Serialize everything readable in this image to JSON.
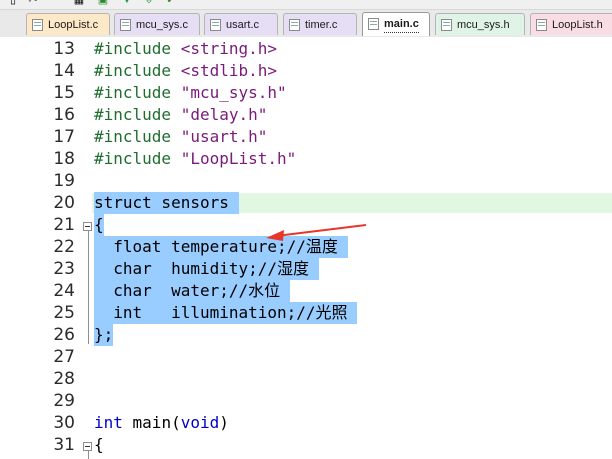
{
  "toolbar": {
    "icons": [
      "document-icon",
      "scissors-icon",
      "grid-icon",
      "save-icon",
      "download-icon",
      "export-icon"
    ]
  },
  "tabs": [
    {
      "label": "LoopList.c",
      "color": "#fde9c7",
      "active": false
    },
    {
      "label": "mcu_sys.c",
      "color": "#e6def4",
      "active": false
    },
    {
      "label": "usart.c",
      "color": "#e6def4",
      "active": false
    },
    {
      "label": "timer.c",
      "color": "#e6def4",
      "active": false
    },
    {
      "label": "main.c",
      "color": "#ffffff",
      "active": true
    },
    {
      "label": "mcu_sys.h",
      "color": "#dff3e6",
      "active": false
    },
    {
      "label": "LoopList.h",
      "color": "#f9dde4",
      "active": false
    }
  ],
  "editor": {
    "lines": [
      {
        "num": "13",
        "text": "#include <string.h>"
      },
      {
        "num": "14",
        "text": "#include <stdlib.h>"
      },
      {
        "num": "15",
        "text": "#include \"mcu_sys.h\""
      },
      {
        "num": "16",
        "text": "#include \"delay.h\""
      },
      {
        "num": "17",
        "text": "#include \"usart.h\""
      },
      {
        "num": "18",
        "text": "#include \"LoopList.h\""
      },
      {
        "num": "19",
        "text": ""
      },
      {
        "num": "20",
        "text": "struct sensors "
      },
      {
        "num": "21",
        "text": "{"
      },
      {
        "num": "22",
        "text": "  float temperature;//温度 "
      },
      {
        "num": "23",
        "text": "  char  humidity;//湿度 "
      },
      {
        "num": "24",
        "text": "  char  water;//水位 "
      },
      {
        "num": "25",
        "text": "  int   illumination;//光照 "
      },
      {
        "num": "26",
        "text": "};"
      },
      {
        "num": "27",
        "text": ""
      },
      {
        "num": "28",
        "text": ""
      },
      {
        "num": "29",
        "text": ""
      },
      {
        "num": "30",
        "text": "int main(void)"
      },
      {
        "num": "31",
        "text": "{"
      }
    ],
    "selected_lines": [
      "20",
      "21",
      "22",
      "23",
      "24",
      "25",
      "26"
    ],
    "current_line": "20",
    "colors": {
      "preprocessor": "#1f6e2e",
      "string": "#7a1a7a",
      "keyword": "#0000cc",
      "selection": "#99ccff",
      "current_line": "#e2f7e2",
      "annotation_arrow": "#e8362b"
    }
  }
}
